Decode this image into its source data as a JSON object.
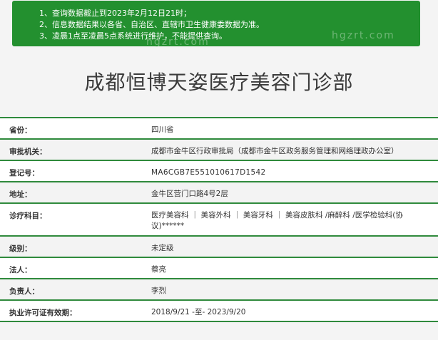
{
  "notice": {
    "lines": [
      "1、查询数据截止到2023年2月12日21时；",
      "2、信息数据结果以各省、自治区、直辖市卫生健康委数据为准。",
      "3、凌晨1点至凌晨5点系统进行维护，不能提供查询。"
    ]
  },
  "watermark": {
    "text": "hgzrt.com"
  },
  "title": "成都恒博天姿医疗美容门诊部",
  "rows": [
    {
      "label": "省份：",
      "value": "四川省"
    },
    {
      "label": "审批机关：",
      "value": "成都市金牛区行政审批局（成都市金牛区政务服务管理和网络理政办公室）"
    },
    {
      "label": "登记号：",
      "value": "MA6CGB7E551010617D1542"
    },
    {
      "label": "地址：",
      "value": "金牛区营门口路4号2层"
    },
    {
      "label": "诊疗科目：",
      "value": "医疗美容科 ｜ 美容外科 ｜ 美容牙科 ｜ 美容皮肤科 /麻醉科 /医学检验科(协议)******"
    },
    {
      "label": "级别：",
      "value": "未定级"
    },
    {
      "label": "法人：",
      "value": "蔡亮"
    },
    {
      "label": "负责人：",
      "value": "李烈"
    },
    {
      "label": "执业许可证有效期：",
      "value": "2018/9/21 -至- 2023/9/20"
    }
  ]
}
